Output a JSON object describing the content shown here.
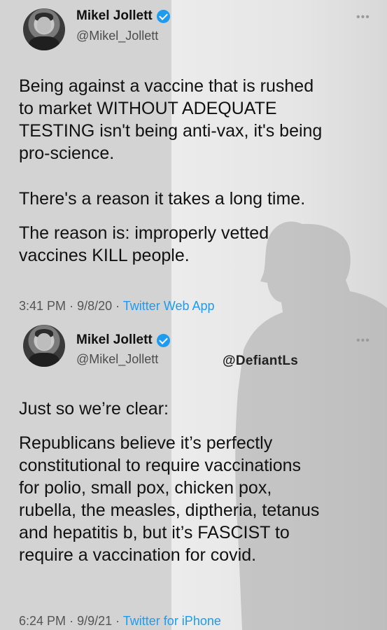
{
  "tweet1": {
    "name": "Mikel Jollett",
    "handle": "@Mikel_Jollett",
    "more": "•••",
    "paragraphs": [
      "Being against a vaccine that is rushed\nto market WITHOUT ADEQUATE\nTESTING isn't being anti-vax, it's being\npro-science.",
      "There's a reason it takes a long time.",
      "The reason is: improperly vetted\nvaccines KILL people."
    ],
    "time": "3:41 PM",
    "date": "9/8/20",
    "source": "Twitter Web App"
  },
  "tweet2": {
    "name": "Mikel Jollett",
    "handle": "@Mikel_Jollett",
    "more": "•••",
    "paragraphs": [
      "Just so we’re clear:",
      "Republicans believe it’s perfectly\nconstitutional to require vaccinations\nfor polio, small pox, chicken pox,\nrubella, the measles, diptheria, tetanus\nand hepatitis b, but it’s FASCIST to\nrequire a vaccination for covid."
    ],
    "time": "6:24 PM",
    "date": "9/9/21",
    "source": "Twitter for iPhone"
  },
  "watermark": "@DefiantLs",
  "colors": {
    "link": "#1d9bf0",
    "verified": "#1d9bf0",
    "text": "#111111"
  }
}
